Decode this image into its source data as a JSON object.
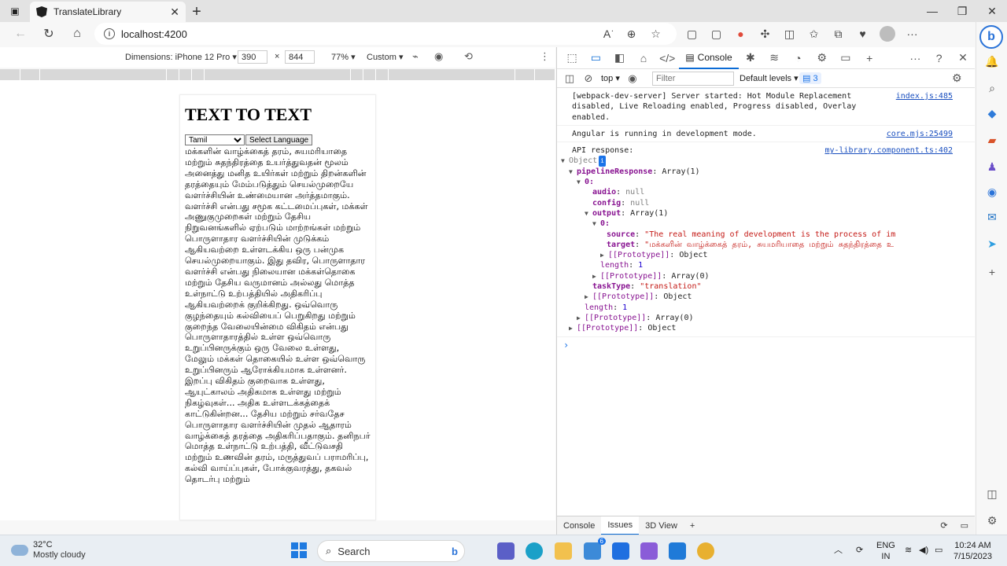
{
  "browser": {
    "tab_title": "TranslateLibrary",
    "url": "localhost:4200"
  },
  "device_toolbar": {
    "dimensions_label": "Dimensions: iPhone 12 Pro",
    "width": "390",
    "height": "844",
    "times": "×",
    "zoom": "77%",
    "throttle": "Custom"
  },
  "app": {
    "heading": "TEXT TO TEXT",
    "selected_language": "Tamil",
    "select_button": "Select Language",
    "output_text": "மக்களின் வாழ்க்கைத் தரம், சுயமரியாதை மற்றும் சுதந்திரத்தை உயர்த்துவதன் மூலம் அனைத்து மனித உயிர்கள் மற்றும் திறன்களின் தரத்தையும் மேம்படுத்தும் செயல்முறையே வளர்ச்சியின் உண்மையான அர்த்தமாகும். வளர்ச்சி என்பது சமூக கட்டமைப்புகள், மக்கள் அணுகுமுறைகள் மற்றும் தேசிய நிறுவனங்களில் ஏற்படும் மாற்றங்கள் மற்றும் பொருளாதார வளர்ச்சியின் முடுக்கம் ஆகியவற்றை உள்ளடக்கிய ஒரு பன்முக செயல்முறையாகும். இது தவிர, பொருளாதார வளர்ச்சி என்பது நிலையான மக்கள்தொகை மற்றும் தேசிய வருமானம் அல்லது மொத்த உள்நாட்டு உற்பத்தியில் அதிகரிப்பு ஆகியவற்றைக் குறிக்கிறது. ஒவ்வொரு குழந்தையும் கல்வியைப் பெறுகிறது மற்றும் குறைந்த வேலையின்மை விகிதம் என்பது பொருளாதாரத்தில் உள்ள ஒவ்வொரு உறுப்பினருக்கும் ஒரு வேலை உள்ளது, மேலும் மக்கள் தொகையில் உள்ள ஒவ்வொரு உறுப்பினரும் ஆரோக்கியமாக உள்ளனர். இறப்பு விகிதம் குறைவாக உள்ளது, ஆயுட்காலம் அதிகமாக உள்ளது மற்றும் நிகழ்வுகள்... அதிக உள்ளடக்கத்தைக் காட்டுகின்றன... தேசிய மற்றும் சர்வதேச பொருளாதார வளர்ச்சியின் முதல் ஆதாரம் வாழ்க்கைத் தரத்தை அதிகரிப்பதாகும். தனிநபர் மொத்த உள்நாட்டு உற்பத்தி, வீட்டுவசதி மற்றும் உணவின் தரம், மருத்துவப் பராமரிப்பு, கல்வி வாய்ப்புகள், போக்குவரத்து, தகவல் தொடர்பு மற்றும்"
  },
  "devtools": {
    "console_tab": "Console",
    "context": "top",
    "filter_placeholder": "Filter",
    "levels": "Default levels",
    "issues_count": "3",
    "messages": {
      "m1_text": "[webpack-dev-server] Server started: Hot Module Replacement disabled, Live Reloading enabled, Progress disabled, Overlay enabled.",
      "m1_src": "index.js:485",
      "m2_text": "Angular is running in development mode.",
      "m2_src": "core.mjs:25499",
      "m3_text": "API response:",
      "m3_src": "my-library.component.ts:402"
    },
    "tree": {
      "object": "Object",
      "badge": "i",
      "pipeline_key": "pipelineResponse",
      "pipeline_val": "Array(1)",
      "idx0": "0:",
      "audio_key": "audio",
      "null": "null",
      "config_key": "config",
      "output_key": "output",
      "output_val": "Array(1)",
      "source_key": "source",
      "source_val": "\"The real meaning of development is the process of improving the quali",
      "target_key": "target",
      "target_val": "\"மக்களின் வாழ்க்கைத் தரம், சுயமரியாதை மற்றும் சுதந்திரத்தை உ",
      "proto_key": "[[Prototype]]",
      "proto_object": "Object",
      "proto_array0": "Array(0)",
      "length_key": "length",
      "one": "1",
      "tasktype_key": "taskType",
      "tasktype_val": "\"translation\""
    },
    "drawer": {
      "console": "Console",
      "issues": "Issues",
      "view3d": "3D View"
    }
  },
  "taskbar": {
    "temp": "32°C",
    "weather": "Mostly cloudy",
    "search": "Search",
    "lang1": "ENG",
    "lang2": "IN",
    "time": "10:24 AM",
    "date": "7/15/2023",
    "badge": "6"
  }
}
